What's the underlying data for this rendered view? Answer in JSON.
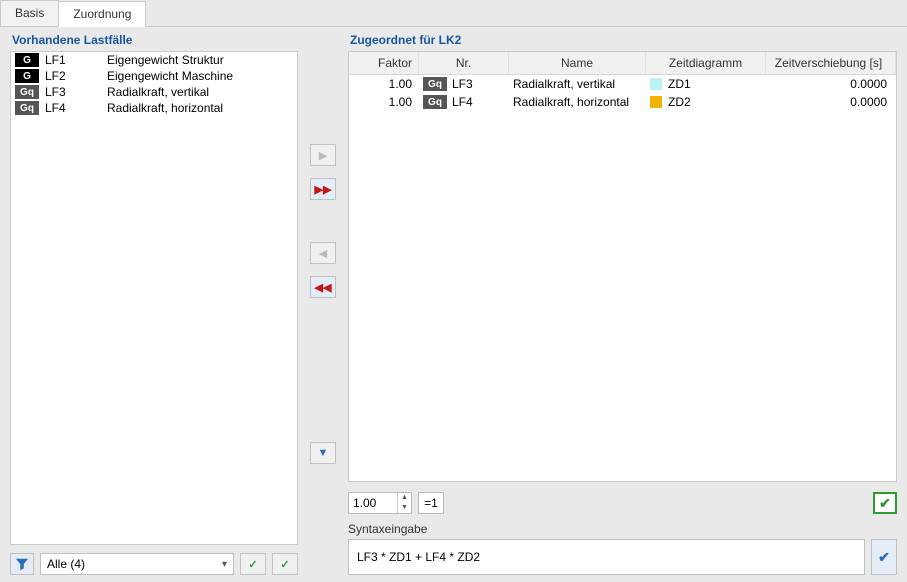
{
  "tabs": {
    "basis": "Basis",
    "zuordnung": "Zuordnung"
  },
  "left": {
    "title": "Vorhandene Lastfälle",
    "items": [
      {
        "badge": "G",
        "badgeClass": "badge-G",
        "code": "LF1",
        "name": "Eigengewicht Struktur"
      },
      {
        "badge": "G",
        "badgeClass": "badge-G",
        "code": "LF2",
        "name": "Eigengewicht Maschine"
      },
      {
        "badge": "Gq",
        "badgeClass": "badge-Gq",
        "code": "LF3",
        "name": "Radialkraft, vertikal"
      },
      {
        "badge": "Gq",
        "badgeClass": "badge-Gq",
        "code": "LF4",
        "name": "Radialkraft, horizontal"
      }
    ],
    "filter_combo": "Alle (4)"
  },
  "right": {
    "title": "Zugeordnet für LK2",
    "headers": {
      "faktor": "Faktor",
      "nr": "Nr.",
      "name": "Name",
      "zeit": "Zeitdiagramm",
      "shift": "Zeitverschiebung [s]"
    },
    "rows": [
      {
        "faktor": "1.00",
        "badge": "Gq",
        "code": "LF3",
        "name": "Radialkraft, vertikal",
        "color": "#b8f3f6",
        "zeit": "ZD1",
        "shift": "0.0000"
      },
      {
        "faktor": "1.00",
        "badge": "Gq",
        "code": "LF4",
        "name": "Radialkraft, horizontal",
        "color": "#f2b200",
        "zeit": "ZD2",
        "shift": "0.0000"
      }
    ],
    "spin_value": "1.00",
    "eq1_label": "=1",
    "syntax_label": "Syntaxeingabe",
    "syntax_value": "LF3 * ZD1 + LF4 * ZD2"
  }
}
